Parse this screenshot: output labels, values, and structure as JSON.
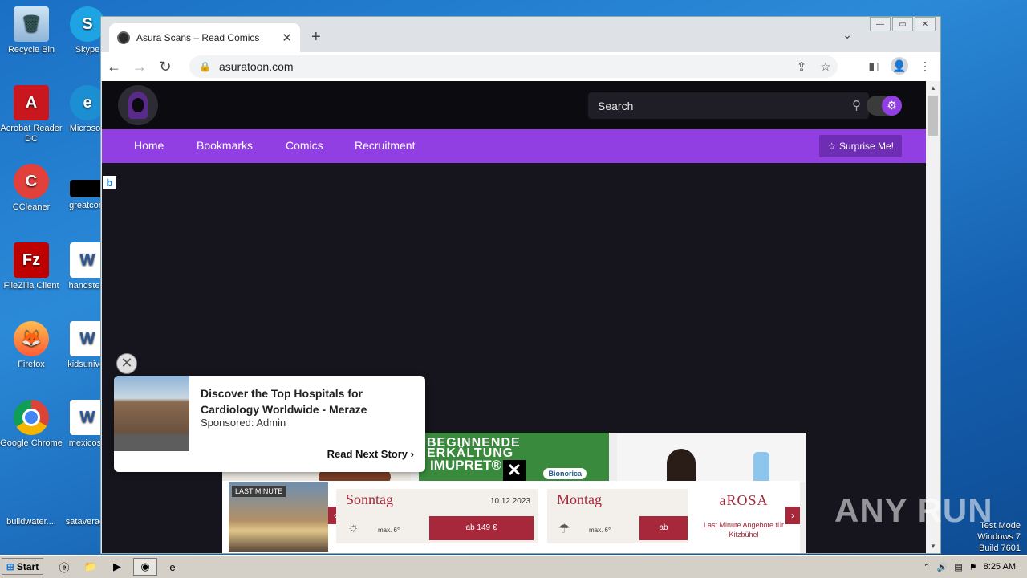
{
  "desktop": {
    "icons": [
      {
        "label": "Recycle Bin"
      },
      {
        "label": "Skype"
      },
      {
        "label": "Acrobat Reader DC"
      },
      {
        "label": "Microsoft"
      },
      {
        "label": "CCleaner"
      },
      {
        "label": "greatcom"
      },
      {
        "label": "FileZilla Client"
      },
      {
        "label": "handstecl"
      },
      {
        "label": "Firefox"
      },
      {
        "label": "kidsuniver"
      },
      {
        "label": "Google Chrome"
      },
      {
        "label": "mexicose"
      },
      {
        "label": "buildwater...."
      },
      {
        "label": "sataverage"
      }
    ]
  },
  "browser": {
    "tab_title": "Asura Scans – Read Comics",
    "tab_close": "✕",
    "new_tab": "+",
    "url": "asuratoon.com"
  },
  "site": {
    "search_placeholder": "Search",
    "nav": [
      "Home",
      "Bookmarks",
      "Comics",
      "Recruitment"
    ],
    "surprise_label": "Surprise Me!",
    "bing_badge": "b"
  },
  "ads": {
    "green_line1": "BEGINNENDE",
    "green_line2": "ERKÄLTUNG",
    "green_line3": "IMUPRET®",
    "green_brand": "Bionorica",
    "last_minute_tag": "LAST MINUTE",
    "days": [
      {
        "name": "Sonntag",
        "date": "10.12.2023",
        "temp": "max. 6°",
        "price": "ab 149 €"
      },
      {
        "name": "Montag",
        "date": "",
        "temp": "max. 6°",
        "price": "ab"
      }
    ],
    "arosa_brand": "aROSA",
    "arosa_promo": "Last Minute Angebote für Kitzbühel",
    "native_headline": "Discover the Top Hospitals for Cardiology Worldwide - Meraze",
    "native_sponsor": "Sponsored: Admin",
    "native_cta": "Read Next Story"
  },
  "taskbar": {
    "start_label": "Start",
    "clock": "8:25 AM"
  },
  "watermark": {
    "line1": "Test Mode",
    "line2": "Windows 7",
    "line3": "Build 7601",
    "anyrun": "ANY RUN"
  }
}
